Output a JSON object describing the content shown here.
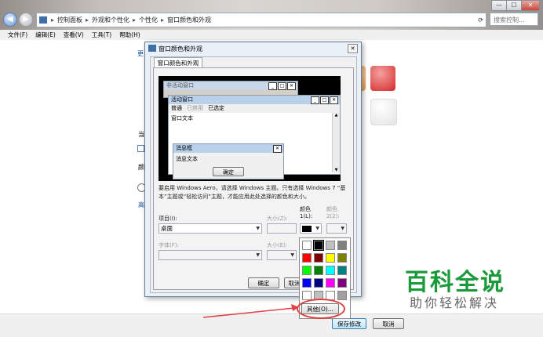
{
  "window": {
    "controls": [
      "—",
      "☐",
      "✕"
    ],
    "breadcrumb": [
      "控制面板",
      "外观和个性化",
      "个性化",
      "窗口颜色和外观"
    ],
    "search_placeholder": "搜索控制...",
    "menu": [
      "文件(F)",
      "编辑(E)",
      "查看(V)",
      "工具(T)",
      "帮助(H)"
    ]
  },
  "background_items": {
    "link_top": "更",
    "text_a": "当",
    "text_b": "颜",
    "link_bottom": "高"
  },
  "footer": {
    "save_label": "保存修改",
    "cancel_label": "取消"
  },
  "dialog": {
    "title": "窗口颜色和外观",
    "tab": "窗口颜色和外观",
    "preview": {
      "inactive_title": "非活动窗口",
      "active_title": "活动窗口",
      "menu_normal": "普通",
      "menu_disabled": "已禁用",
      "menu_selected": "已选定",
      "window_text": "窗口文本",
      "msgbox_title": "消息框",
      "msgbox_text": "消息文本",
      "ok_label": "确定"
    },
    "description": "要启用 Windows Aero，请选择 Windows 主题。只有选择 Windows 7 “基本”主题或“轻松访问”主题，才能应用此处选择的颜色和大小。",
    "item_label": "项目(I):",
    "item_value": "桌面",
    "size_label": "大小(Z):",
    "color1_label": "颜色 1(L):",
    "color2_label": "颜色 2(2):",
    "font_label": "字体(F):",
    "font_size_label": "大小(E):",
    "ok_button": "确定",
    "cancel_button": "取消",
    "other_button": "其他(O)..."
  },
  "palette": {
    "colors": [
      "#ffffff",
      "#000000",
      "#c0c0c0",
      "#808080",
      "#ff0000",
      "#800000",
      "#ffff00",
      "#808000",
      "#00ff00",
      "#008000",
      "#00ffff",
      "#008080",
      "#0000ff",
      "#000080",
      "#ff00ff",
      "#800080",
      "#ffffff",
      "#c0c0c0",
      "#ffffff",
      "#a0a0a0"
    ]
  },
  "watermark": {
    "line1": "百科全说",
    "line2": "助你轻松解决"
  }
}
